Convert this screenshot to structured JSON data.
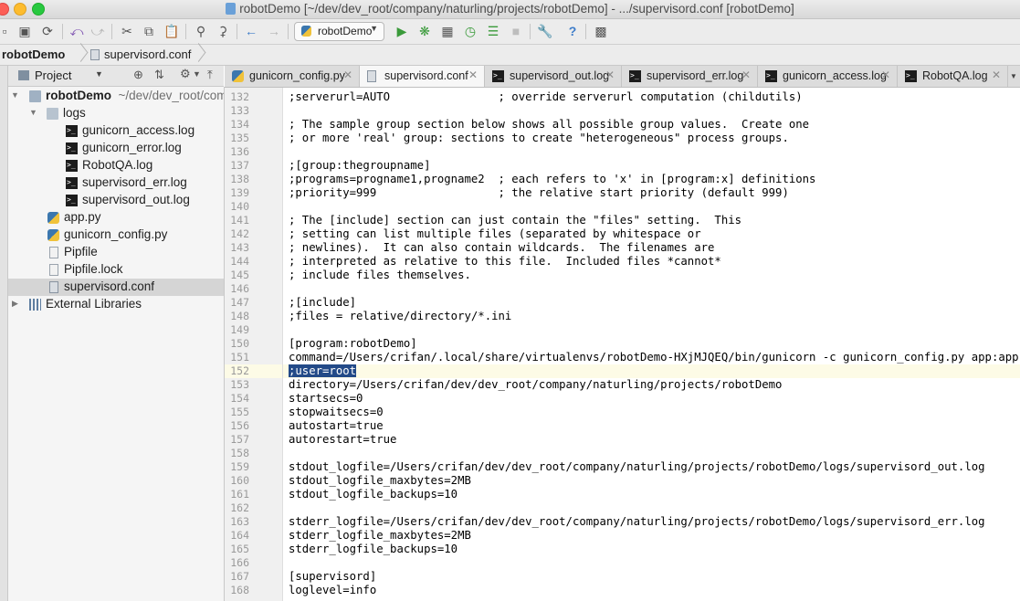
{
  "window": {
    "title": "robotDemo [~/dev/dev_root/company/naturling/projects/robotDemo] - .../supervisord.conf [robotDemo]"
  },
  "toolbar": {
    "run_config": "robotDemo",
    "icons": [
      "save-icon",
      "sync-icon",
      "undo-icon",
      "redo-icon",
      "cut-icon",
      "copy-icon",
      "paste-icon",
      "find-icon",
      "replace-icon",
      "back-icon",
      "forward-icon",
      "run-icon",
      "debug-icon",
      "coverage-icon",
      "profile-icon",
      "concurrency-icon",
      "stop-icon",
      "settings-icon",
      "help-icon",
      "vcs-icon"
    ]
  },
  "navbar": {
    "project": "robotDemo",
    "file": "supervisord.conf"
  },
  "project_panel": {
    "title": "Project",
    "root_name": "robotDemo",
    "root_path": "~/dev/dev_root/company/naturling/projects/robotDemo",
    "logs_folder": "logs",
    "log_files": [
      "gunicorn_access.log",
      "gunicorn_error.log",
      "RobotQA.log",
      "supervisord_err.log",
      "supervisord_out.log"
    ],
    "files": [
      "app.py",
      "gunicorn_config.py",
      "Pipfile",
      "Pipfile.lock",
      "supervisord.conf"
    ],
    "external": "External Libraries"
  },
  "tabs": [
    {
      "label": "gunicorn_config.py",
      "icon": "python-file-icon",
      "active": false
    },
    {
      "label": "supervisord.conf",
      "icon": "config-file-icon",
      "active": true
    },
    {
      "label": "supervisord_out.log",
      "icon": "terminal-log-icon",
      "active": false
    },
    {
      "label": "supervisord_err.log",
      "icon": "terminal-log-icon",
      "active": false
    },
    {
      "label": "gunicorn_access.log",
      "icon": "terminal-log-icon",
      "active": false
    },
    {
      "label": "RobotQA.log",
      "icon": "terminal-log-icon",
      "active": false
    }
  ],
  "editor": {
    "current_line": 152,
    "selected_text": ";user=root",
    "lines": [
      {
        "num": "132",
        "text": ";serverurl=AUTO                ; override serverurl computation (childutils)"
      },
      {
        "num": "133",
        "text": ""
      },
      {
        "num": "134",
        "text": "; The sample group section below shows all possible group values.  Create one"
      },
      {
        "num": "135",
        "text": "; or more 'real' group: sections to create \"heterogeneous\" process groups."
      },
      {
        "num": "136",
        "text": ""
      },
      {
        "num": "137",
        "text": ";[group:thegroupname]"
      },
      {
        "num": "138",
        "text": ";programs=progname1,progname2  ; each refers to 'x' in [program:x] definitions"
      },
      {
        "num": "139",
        "text": ";priority=999                  ; the relative start priority (default 999)"
      },
      {
        "num": "140",
        "text": ""
      },
      {
        "num": "141",
        "text": "; The [include] section can just contain the \"files\" setting.  This"
      },
      {
        "num": "142",
        "text": "; setting can list multiple files (separated by whitespace or"
      },
      {
        "num": "143",
        "text": "; newlines).  It can also contain wildcards.  The filenames are"
      },
      {
        "num": "144",
        "text": "; interpreted as relative to this file.  Included files *cannot*"
      },
      {
        "num": "145",
        "text": "; include files themselves."
      },
      {
        "num": "146",
        "text": ""
      },
      {
        "num": "147",
        "text": ";[include]"
      },
      {
        "num": "148",
        "text": ";files = relative/directory/*.ini"
      },
      {
        "num": "149",
        "text": ""
      },
      {
        "num": "150",
        "text": "[program:robotDemo]"
      },
      {
        "num": "151",
        "text": "command=/Users/crifan/.local/share/virtualenvs/robotDemo-HXjMJQEQ/bin/gunicorn -c gunicorn_config.py app:app"
      },
      {
        "num": "152",
        "text": ";user=root"
      },
      {
        "num": "153",
        "text": "directory=/Users/crifan/dev/dev_root/company/naturling/projects/robotDemo"
      },
      {
        "num": "154",
        "text": "startsecs=0"
      },
      {
        "num": "155",
        "text": "stopwaitsecs=0"
      },
      {
        "num": "156",
        "text": "autostart=true"
      },
      {
        "num": "157",
        "text": "autorestart=true"
      },
      {
        "num": "158",
        "text": ""
      },
      {
        "num": "159",
        "text": "stdout_logfile=/Users/crifan/dev/dev_root/company/naturling/projects/robotDemo/logs/supervisord_out.log"
      },
      {
        "num": "160",
        "text": "stdout_logfile_maxbytes=2MB"
      },
      {
        "num": "161",
        "text": "stdout_logfile_backups=10"
      },
      {
        "num": "162",
        "text": ""
      },
      {
        "num": "163",
        "text": "stderr_logfile=/Users/crifan/dev/dev_root/company/naturling/projects/robotDemo/logs/supervisord_err.log"
      },
      {
        "num": "164",
        "text": "stderr_logfile_maxbytes=2MB"
      },
      {
        "num": "165",
        "text": "stderr_logfile_backups=10"
      },
      {
        "num": "166",
        "text": ""
      },
      {
        "num": "167",
        "text": "[supervisord]"
      },
      {
        "num": "168",
        "text": "loglevel=info"
      }
    ]
  }
}
